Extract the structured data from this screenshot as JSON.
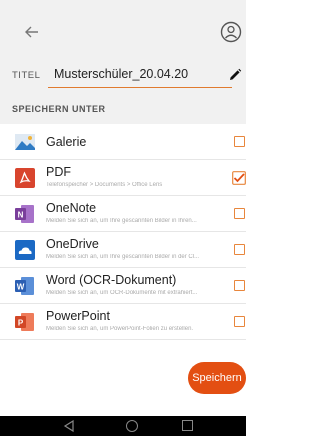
{
  "header": {
    "back_icon": "arrow-left-icon",
    "account_icon": "account-circle-icon"
  },
  "title_field": {
    "label": "TITEL",
    "value": "Musterschüler_20.04.20",
    "edit_icon": "pencil-icon"
  },
  "section": {
    "label": "SPEICHERN UNTER"
  },
  "destinations": [
    {
      "name": "Galerie",
      "subtitle": "",
      "icon": "gallery-icon",
      "checked": false
    },
    {
      "name": "PDF",
      "subtitle": "Telefonspeicher > Documents > Office Lens",
      "icon": "pdf-icon",
      "checked": true
    },
    {
      "name": "OneNote",
      "subtitle": "Melden Sie sich an, um Ihre gescannten Bilder in Ihren...",
      "icon": "onenote-icon",
      "checked": false
    },
    {
      "name": "OneDrive",
      "subtitle": "Melden Sie sich an, um Ihre gescannten Bilder in der Cl...",
      "icon": "onedrive-icon",
      "checked": false
    },
    {
      "name": "Word (OCR-Dokument)",
      "subtitle": "Melden Sie sich an, um OCR-Dokumente mit extrahiert...",
      "icon": "word-icon",
      "checked": false
    },
    {
      "name": "PowerPoint",
      "subtitle": "Melden Sie sich an, um PowerPoint-Folien zu erstellen.",
      "icon": "powerpoint-icon",
      "checked": false
    }
  ],
  "save_button": {
    "label": "Speichern"
  },
  "colors": {
    "accent": "#e34f12",
    "checkbox": "#e8863c",
    "pdf": "#d8452e",
    "onenote": "#7a3f9b",
    "onedrive": "#1b69c4",
    "word": "#2b5fb3",
    "powerpoint": "#d24726"
  }
}
